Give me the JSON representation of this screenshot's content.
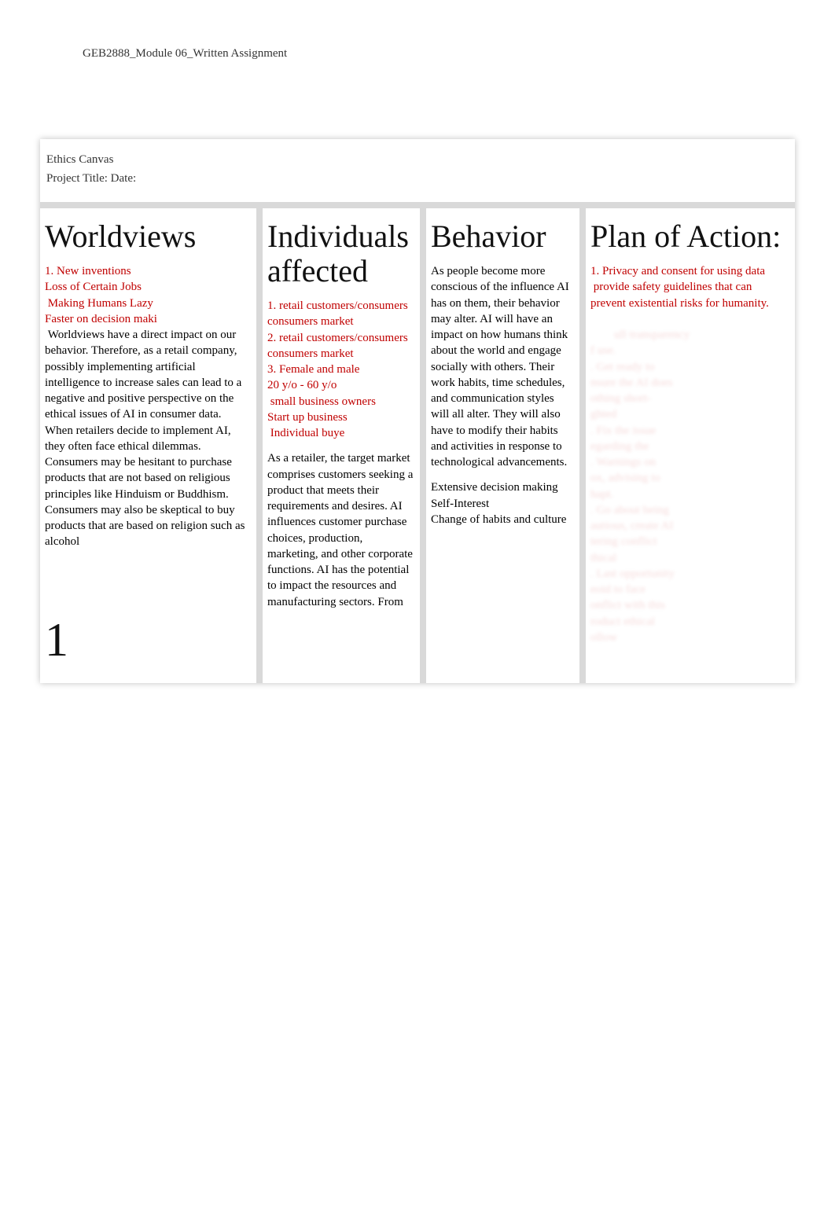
{
  "header": {
    "title": "GEB2888_Module 06_Written Assignment"
  },
  "canvas": {
    "label": "Ethics Canvas",
    "project_line": "Project Title: Date:"
  },
  "columns": {
    "worldviews": {
      "title": "Worldviews",
      "red_list": "1. New inventions\nLoss of Certain Jobs\n Making Humans Lazy\nFaster on decision maki",
      "body": " Worldviews have a direct impact on our behavior. Therefore, as a retail company, possibly implementing artificial intelligence to increase sales can lead to a negative and positive perspective on the ethical issues of AI in consumer data. When retailers decide to implement AI, they often face ethical dilemmas. Consumers may be hesitant to purchase products that are not based on religious principles like Hinduism or Buddhism. Consumers may also be skeptical to buy products that are based on religion such as alcohol",
      "big": "1"
    },
    "individuals": {
      "title": "Individuals affected",
      "red_list": "1. retail customers/consumers\nconsumers market\n2. retail customers/consumers\nconsumers market\n3. Female and male\n20 y/o - 60 y/o\n small business owners\nStart up business\n Individual buye",
      "desc": "As a retailer, the target market comprises customers seeking a product that meets their requirements and desires. AI influences customer purchase choices, production, marketing, and other corporate functions. AI has the potential to impact the resources and manufacturing sectors. From"
    },
    "behavior": {
      "title": "Behavior",
      "body": "As people become more conscious of the influence AI has on them, their behavior may alter. AI will have an impact on how humans think about the world and engage socially with others. Their work habits, time schedules, and communication styles will all alter. They will also have to modify their habits and activities in response to technological advancements.",
      "list": "Extensive decision making\nSelf-Interest\nChange of habits and culture"
    },
    "plan": {
      "title": "Plan of Action:",
      "red_list_visible": "1. Privacy and consent for using data\n provide safety guidelines that can prevent existential risks for humanity.",
      "hidden": "ull transparency\nf use.\n. Get ready to\nnsure the AI does\nothing short-\nghted\n. Fix the issue\negarding the\n. Warnings on\nox, advising to\nhapt.\n. Go about being\nautious, create AI\ntering conflict\nthical\n. Last opportunity\neoid to face\nonflict with this\nroduct ethical\nollow"
    }
  }
}
